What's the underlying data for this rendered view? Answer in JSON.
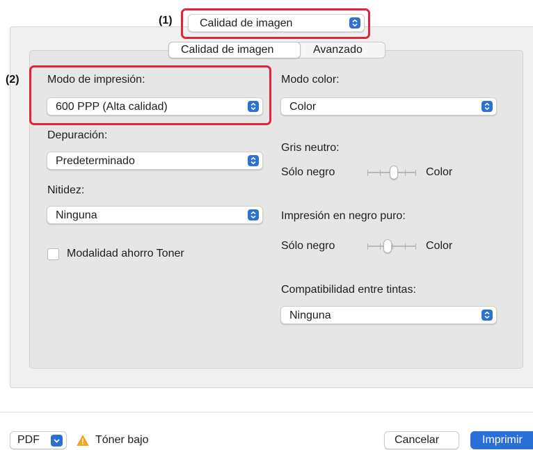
{
  "header": {
    "callout_1": "(1)",
    "panel_select_value": "Calidad de imagen"
  },
  "tabs": [
    {
      "label": "Calidad de imagen",
      "selected": true
    },
    {
      "label": "Avanzado",
      "selected": false
    }
  ],
  "left": {
    "callout_2": "(2)",
    "print_mode_label": "Modo de impresión:",
    "print_mode_value": "600 PPP (Alta calidad)",
    "debug_label": "Depuración:",
    "debug_value": "Predeterminado",
    "sharpness_label": "Nitidez:",
    "sharpness_value": "Ninguna",
    "toner_save_label": "Modalidad ahorro Toner",
    "toner_save_checked": false
  },
  "right": {
    "color_mode_label": "Modo color:",
    "color_mode_value": "Color",
    "neutral_gray_label": "Gris neutro:",
    "neutral_gray_left": "Sólo negro",
    "neutral_gray_right": "Color",
    "neutral_gray_level": 0.55,
    "pure_black_label": "Impresión en negro puro:",
    "pure_black_left": "Sólo negro",
    "pure_black_right": "Color",
    "pure_black_level": 0.4,
    "ink_compat_label": "Compatibilidad entre tintas:",
    "ink_compat_value": "Ninguna"
  },
  "footer": {
    "pdf_label": "PDF",
    "warning_text": "Tóner bajo",
    "cancel_label": "Cancelar",
    "print_label": "Imprimir"
  },
  "colors": {
    "accent": "#2a6fd8",
    "highlight_box": "#e3233b",
    "warning": "#f2a81d"
  },
  "icons": [
    "chevron-updown-icon",
    "chevron-down-icon",
    "warning-icon"
  ]
}
